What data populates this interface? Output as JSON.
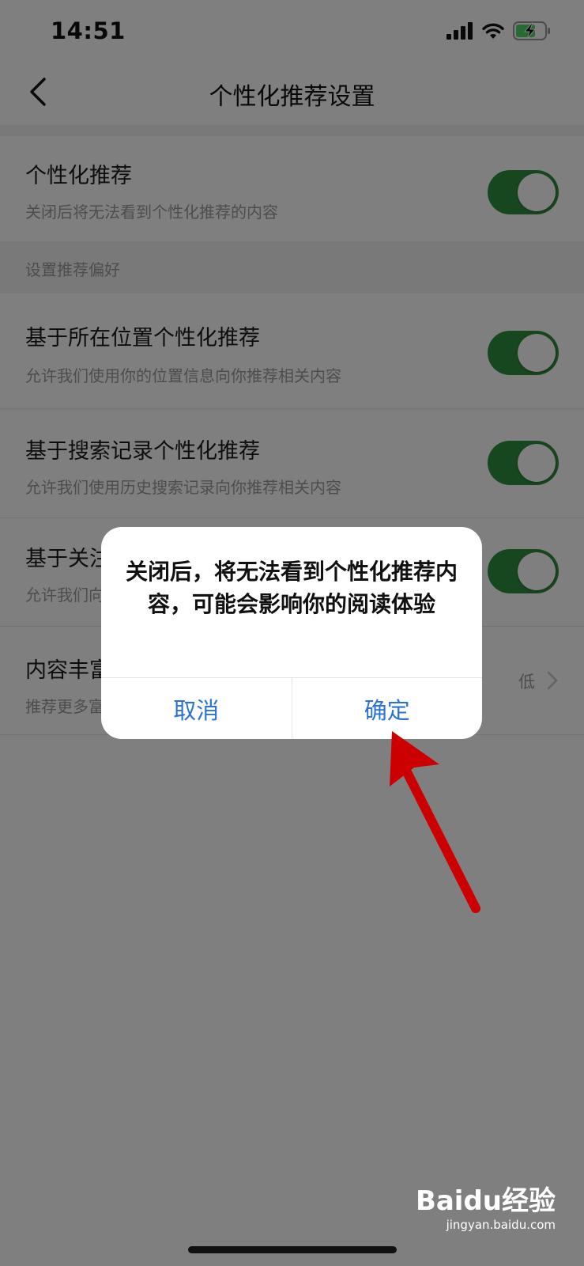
{
  "status_bar": {
    "time": "14:51",
    "icons": [
      "signal-icon",
      "wifi-icon",
      "battery-charging-icon"
    ]
  },
  "nav": {
    "title": "个性化推荐设置"
  },
  "settings": {
    "personalized": {
      "title": "个性化推荐",
      "subtitle": "关闭后将无法看到个性化推荐的内容",
      "on": true
    },
    "section_header": "设置推荐偏好",
    "location": {
      "title": "基于所在位置个性化推荐",
      "subtitle": "允许我们使用你的位置信息向你推荐相关内容",
      "on": true
    },
    "search_history": {
      "title": "基于搜索记录个性化推荐",
      "subtitle": "允许我们使用历史搜索记录向你推荐相关内容",
      "on": true
    },
    "follow": {
      "title": "基于关注",
      "subtitle": "允许我们向",
      "on": true
    },
    "richness": {
      "title": "内容丰富",
      "subtitle": "推荐更多富",
      "value": "低"
    }
  },
  "dialog": {
    "message": "关闭后，将无法看到个性化推荐内容，可能会影响你的阅读体验",
    "cancel_label": "取消",
    "confirm_label": "确定"
  },
  "colors": {
    "toggle_on": "#2f8f3c",
    "dialog_button": "#2a72d6",
    "annotation_arrow": "#cc0000"
  },
  "watermark": {
    "logo": "Baidu经验",
    "url": "jingyan.baidu.com"
  }
}
